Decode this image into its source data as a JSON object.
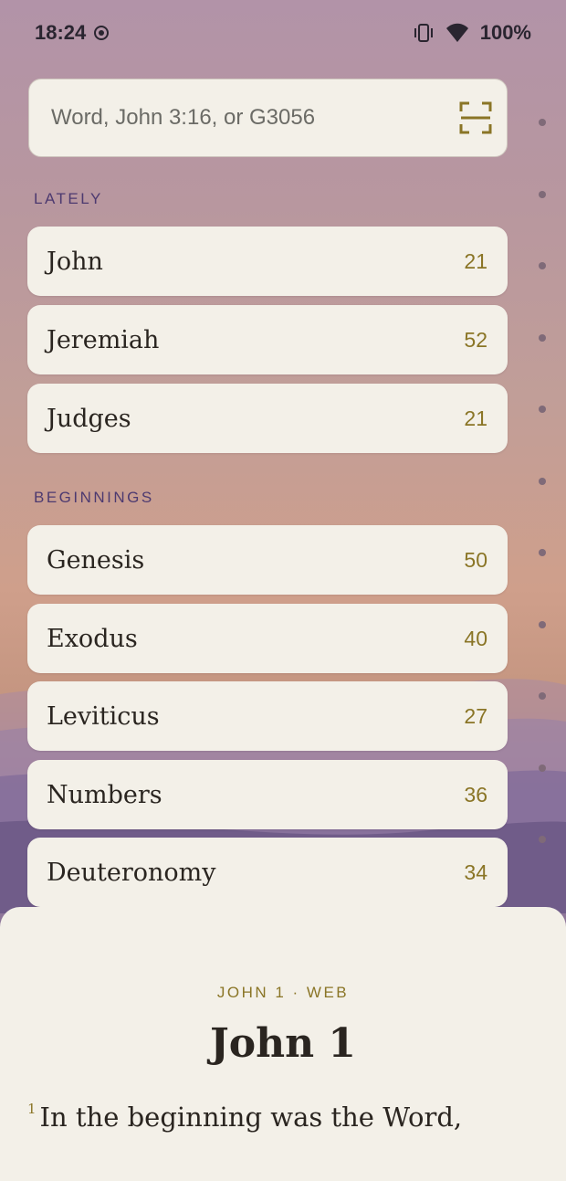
{
  "status_bar": {
    "time": "18:24",
    "battery": "100%"
  },
  "search": {
    "placeholder": "Word, John 3:16, or G3056"
  },
  "sections": {
    "lately": {
      "label": "LATELY",
      "books": [
        {
          "name": "John",
          "chapters": "21"
        },
        {
          "name": "Jeremiah",
          "chapters": "52"
        },
        {
          "name": "Judges",
          "chapters": "21"
        }
      ]
    },
    "beginnings": {
      "label": "BEGINNINGS",
      "books": [
        {
          "name": "Genesis",
          "chapters": "50"
        },
        {
          "name": "Exodus",
          "chapters": "40"
        },
        {
          "name": "Leviticus",
          "chapters": "27"
        },
        {
          "name": "Numbers",
          "chapters": "36"
        },
        {
          "name": "Deuteronomy",
          "chapters": "34"
        }
      ]
    }
  },
  "reader": {
    "reference": "JOHN 1 · WEB",
    "title": "John 1",
    "verse_number": "1",
    "verse_text": "In the beginning was the Word,"
  },
  "colors": {
    "accent": "#8a7526",
    "section_label": "#4d3a70",
    "card": "#f3f0e8"
  }
}
